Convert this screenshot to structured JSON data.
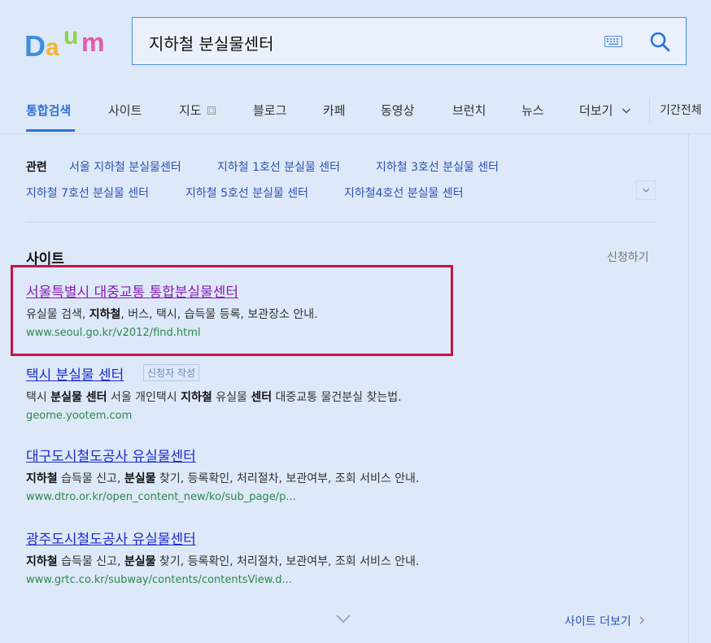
{
  "brand": {
    "logo_text": "Daum",
    "colors": {
      "D": "#3f8ee0",
      "a": "#f2b530",
      "u": "#8ed44f",
      "m": "#e858a8"
    }
  },
  "search": {
    "query": "지하철 분실물센터",
    "placeholder": "",
    "keyboard_icon": "keyboard-icon",
    "button_icon": "search-icon"
  },
  "tabs": [
    {
      "label": "통합검색",
      "active": true
    },
    {
      "label": "사이트"
    },
    {
      "label": "지도"
    },
    {
      "label": "블로그"
    },
    {
      "label": "카페"
    },
    {
      "label": "동영상"
    },
    {
      "label": "브런치"
    },
    {
      "label": "뉴스"
    },
    {
      "label": "더보기"
    }
  ],
  "period_label": "기간전체",
  "related": {
    "title": "관련",
    "links": [
      "서울 지하철 분실물센터",
      "지하철 1호선 분실물 센터",
      "지하철 3호선 분실물 센터",
      "지하철 7호선 분실물 센터",
      "지하철 5호선 분실물 센터",
      "지하철4호선 분실물 센터"
    ]
  },
  "site_section": {
    "title": "사이트",
    "apply_label": "신청하기",
    "results": [
      {
        "title": "서울특별시 대중교통 통합분실물센터",
        "desc": "유실물 검색, 지하철, 버스, 택시, 습득물 등록, 보관장소 안내.",
        "url": "www.seoul.go.kr/v2012/find.html"
      },
      {
        "title": "택시 분실물 센터",
        "badge": "신청자 작성",
        "desc": "택시 분실물 센터 서울 개인택시 지하철 유실물 센터 대중교통 물건분실 찾는법.",
        "url": "geome.yootem.com"
      },
      {
        "title": "대구도시철도공사 유실물센터",
        "desc": "지하철 습득물 신고, 분실물 찾기, 등록확인, 처리절차, 보관여부, 조회 서비스 안내.",
        "url": "www.dtro.or.kr/open_content_new/ko/sub_page/p..."
      },
      {
        "title": "광주도시철도공사 유실물센터",
        "desc": "지하철 습득물 신고, 분실물 찾기, 등록확인, 처리절차, 보관여부, 조회 서비스 안내.",
        "url": "www.grtc.co.kr/subway/contents/contentsView.d..."
      }
    ],
    "more_label": "사이트 더보기"
  },
  "highlight_color": "#c4134a"
}
